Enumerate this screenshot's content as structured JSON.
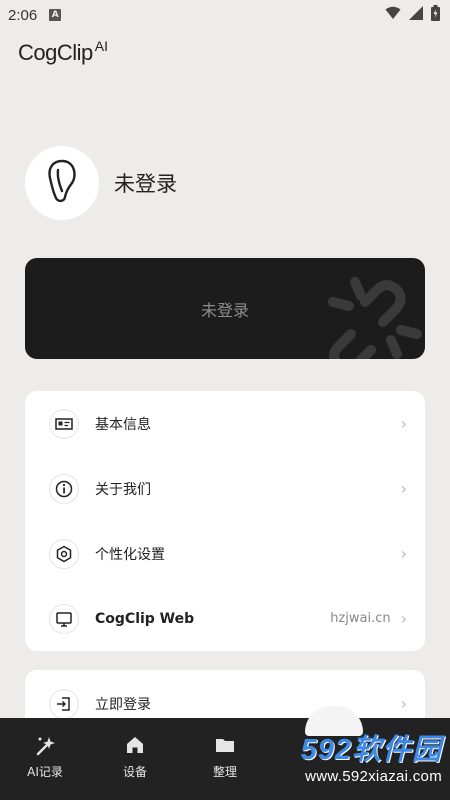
{
  "status_bar": {
    "time": "2:06",
    "notif_badge": "A"
  },
  "app": {
    "logo": "CogClip",
    "logo_sup": "AI"
  },
  "profile": {
    "name": "未登录"
  },
  "login_card": {
    "text": "未登录"
  },
  "menu": {
    "items": [
      {
        "label": "基本信息",
        "icon": "id-card-icon"
      },
      {
        "label": "关于我们",
        "icon": "info-icon"
      },
      {
        "label": "个性化设置",
        "icon": "settings-icon"
      },
      {
        "label": "CogClip Web",
        "value": "hzjwai.cn",
        "icon": "monitor-icon"
      }
    ],
    "login_item": {
      "label": "立即登录",
      "icon": "login-icon"
    }
  },
  "tabs": [
    {
      "label": "AI记录",
      "icon": "sparkle-icon"
    },
    {
      "label": "设备",
      "icon": "home-icon"
    },
    {
      "label": "整理",
      "icon": "folder-icon"
    }
  ],
  "watermark": {
    "title": "592软件园",
    "url": "www.592xiazai.com"
  },
  "colors": {
    "background": "#edecea",
    "card_dark": "#1c1c1c",
    "tab_bar": "#222222",
    "watermark_blue": "#3d8ae6"
  }
}
